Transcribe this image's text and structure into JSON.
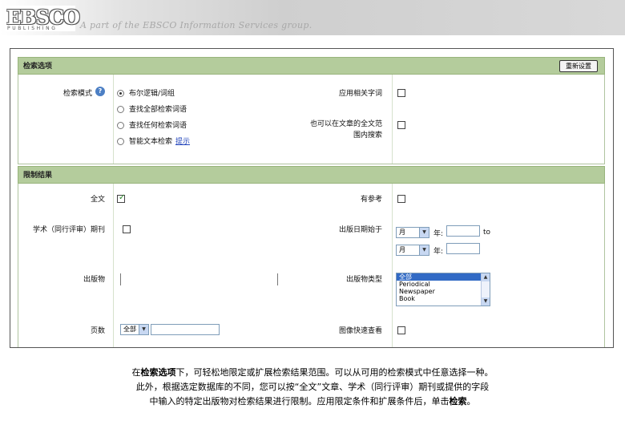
{
  "header": {
    "logo_text": "EBSCO",
    "logo_subtext": "PUBLISHING",
    "tagline": "A part of the EBSCO Information Services group."
  },
  "search_options": {
    "section_title": "检索选项",
    "reset_label": "重新设置",
    "search_mode_label": "检索模式",
    "modes": [
      {
        "label": "布尔逻辑/词组",
        "selected": true
      },
      {
        "label": "查找全部检索词语",
        "selected": false
      },
      {
        "label": "查找任何检索词语",
        "selected": false
      },
      {
        "label": "智能文本检索",
        "selected": false,
        "link": "提示"
      }
    ],
    "related_words_label": "应用相关字词",
    "fulltext_label_line1": "也可以在文章的全文范",
    "fulltext_label_line2": "围内搜索"
  },
  "limit_results": {
    "section_title": "限制结果",
    "fulltext_label": "全文",
    "fulltext_checked": true,
    "references_label": "有参考",
    "peer_reviewed_label": "学术（同行评审）期刊",
    "pub_date_label": "出版日期始于",
    "month_label": "月",
    "year_label": "年:",
    "to_label": "to",
    "publication_label": "出版物",
    "pub_type_label": "出版物类型",
    "pub_types": [
      "全部",
      "Periodical",
      "Newspaper",
      "Book"
    ],
    "pages_label": "页数",
    "pages_select": "全部",
    "image_quick_view_label": "图像快速查看"
  },
  "caption": {
    "line1_pre": "在",
    "line1_bold": "检索选项",
    "line1_post": "下，可轻松地限定或扩展检索结果范围。可以从可用的检索模式中任意选择一种。",
    "line2": "此外，根据选定数据库的不同，您可以按“全文”文章、学术（同行评审）期刊或提供的字段",
    "line3_pre": "中输入的特定出版物对检索结果进行限制。应用限定条件和扩展条件后，单击",
    "line3_bold": "检索",
    "line3_post": "。"
  }
}
